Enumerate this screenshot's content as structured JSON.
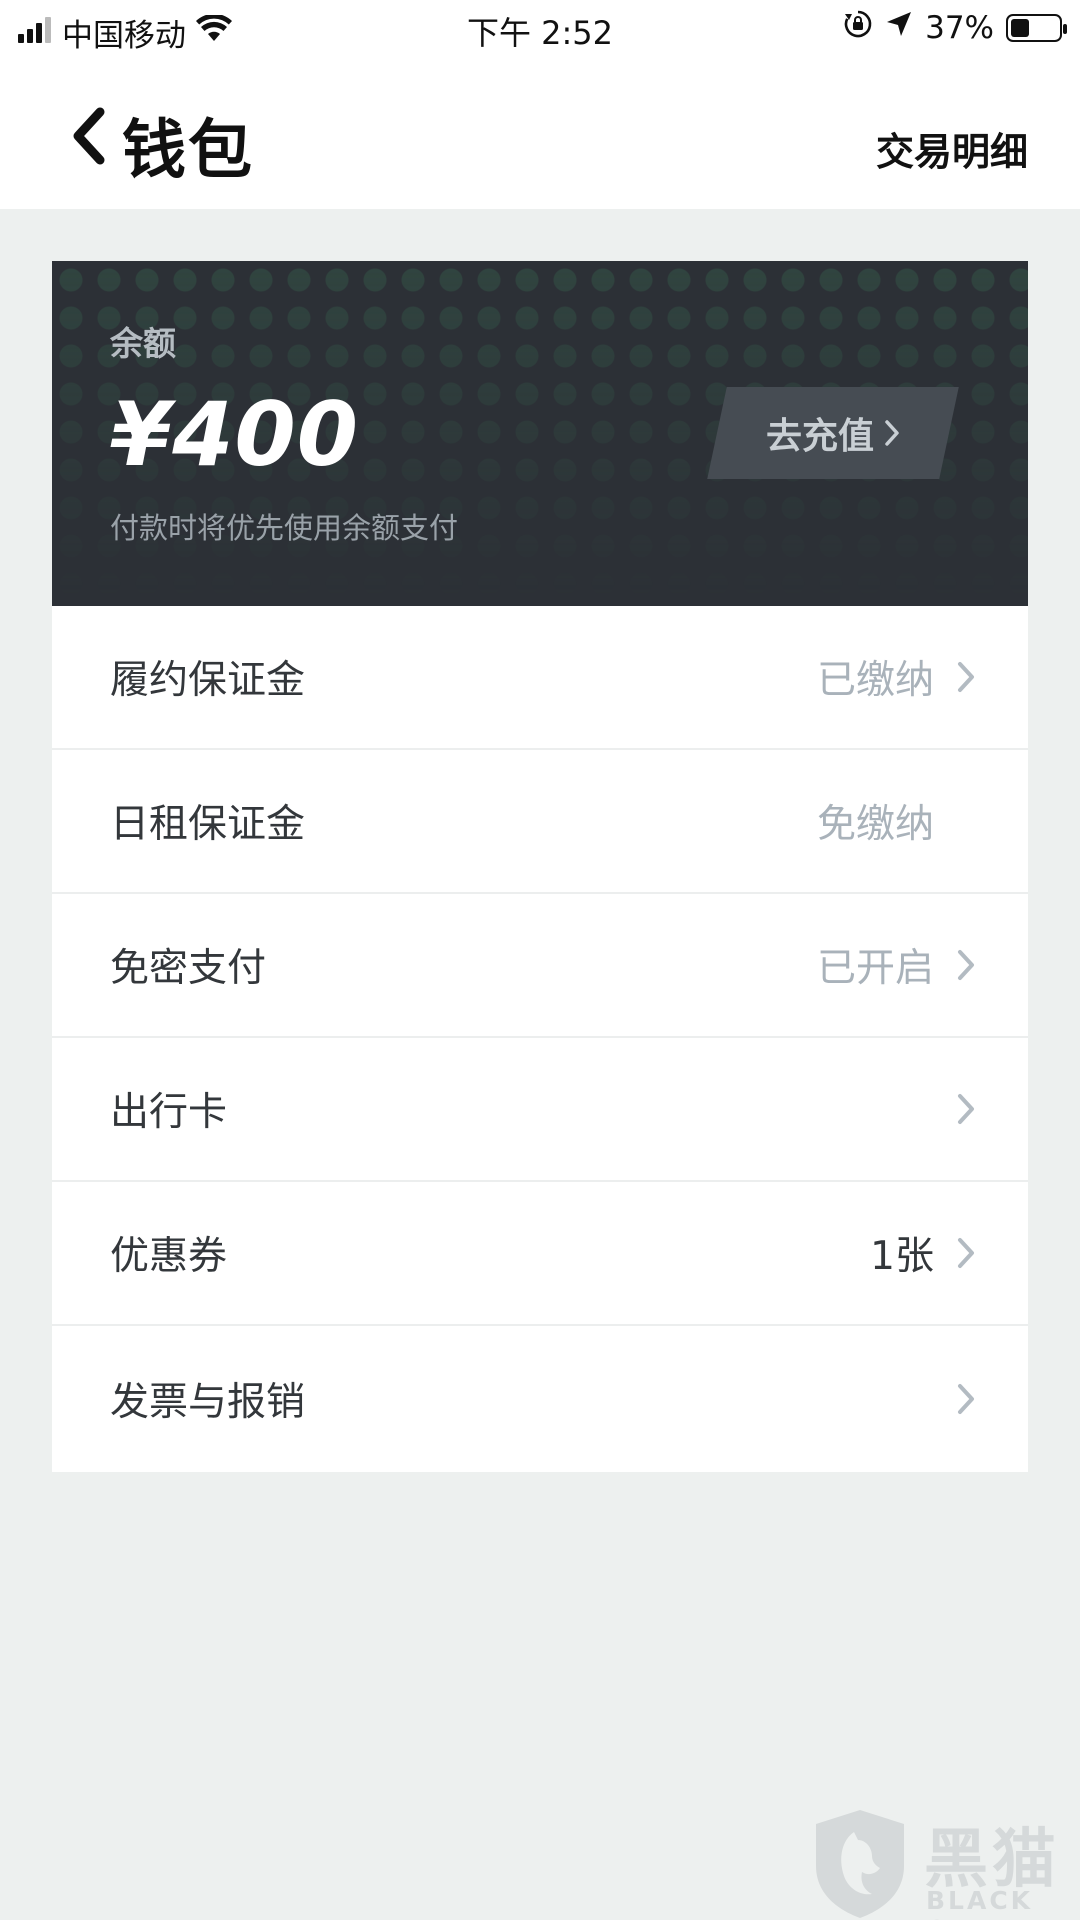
{
  "status_bar": {
    "carrier": "中国移动",
    "time": "下午 2:52",
    "battery_percent": "37%",
    "battery_level": 0.37,
    "icons": [
      "signal-icon",
      "wifi-icon",
      "rotation-lock-icon",
      "location-icon",
      "battery-icon"
    ]
  },
  "header": {
    "back_icon": "chevron-left-icon",
    "title": "钱包",
    "right_link": "交易明细"
  },
  "balance_card": {
    "label": "余额",
    "amount": "¥400",
    "note": "付款时将优先使用余额支付",
    "recharge_label": "去充值",
    "recharge_icon": "chevron-right-icon"
  },
  "menu": {
    "items": [
      {
        "label": "履约保证金",
        "value": "已缴纳",
        "chevron": true
      },
      {
        "label": "日租保证金",
        "value": "免缴纳",
        "chevron": false
      },
      {
        "label": "免密支付",
        "value": "已开启",
        "chevron": true
      },
      {
        "label": "出行卡",
        "value": "",
        "chevron": true
      },
      {
        "label": "优惠券",
        "value": "1张",
        "chevron": true
      },
      {
        "label": "发票与报销",
        "value": "",
        "chevron": true
      }
    ]
  },
  "watermark": {
    "title": "黑猫",
    "subtitle": "BLACK CAT"
  },
  "colors": {
    "card_background": "#2c3036",
    "muted_value": "#a9b2ba",
    "page_background": "#edf0ef"
  }
}
